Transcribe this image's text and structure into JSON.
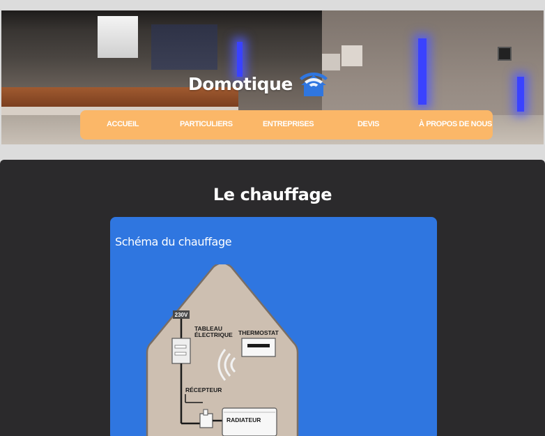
{
  "header": {
    "brand_title": "Domotique",
    "brand_icon": "wifi-house-icon",
    "nav": [
      {
        "label": "ACCUEIL"
      },
      {
        "label": "PARTICULIERS"
      },
      {
        "label": "ENTREPRISES"
      },
      {
        "label": "DEVIS"
      },
      {
        "label": "À PROPOS DE NOUS"
      }
    ],
    "nav_color": "#fbb768"
  },
  "main": {
    "section_title": "Le chauffage",
    "card": {
      "title": "Schéma du chauffage",
      "color": "#2f76e0",
      "diagram": {
        "voltage_label": "230V",
        "panel_label_line1": "TABLEAU",
        "panel_label_line2": "ÉLECTRIQUE",
        "thermostat_label": "THERMOSTAT",
        "receiver_label": "RÉCEPTEUR",
        "radiator_label": "RADIATEUR"
      }
    }
  },
  "colors": {
    "page_bg": "#dcdcdc",
    "content_bg": "#2b2a2c",
    "brand_icon": "#2f76e0"
  }
}
